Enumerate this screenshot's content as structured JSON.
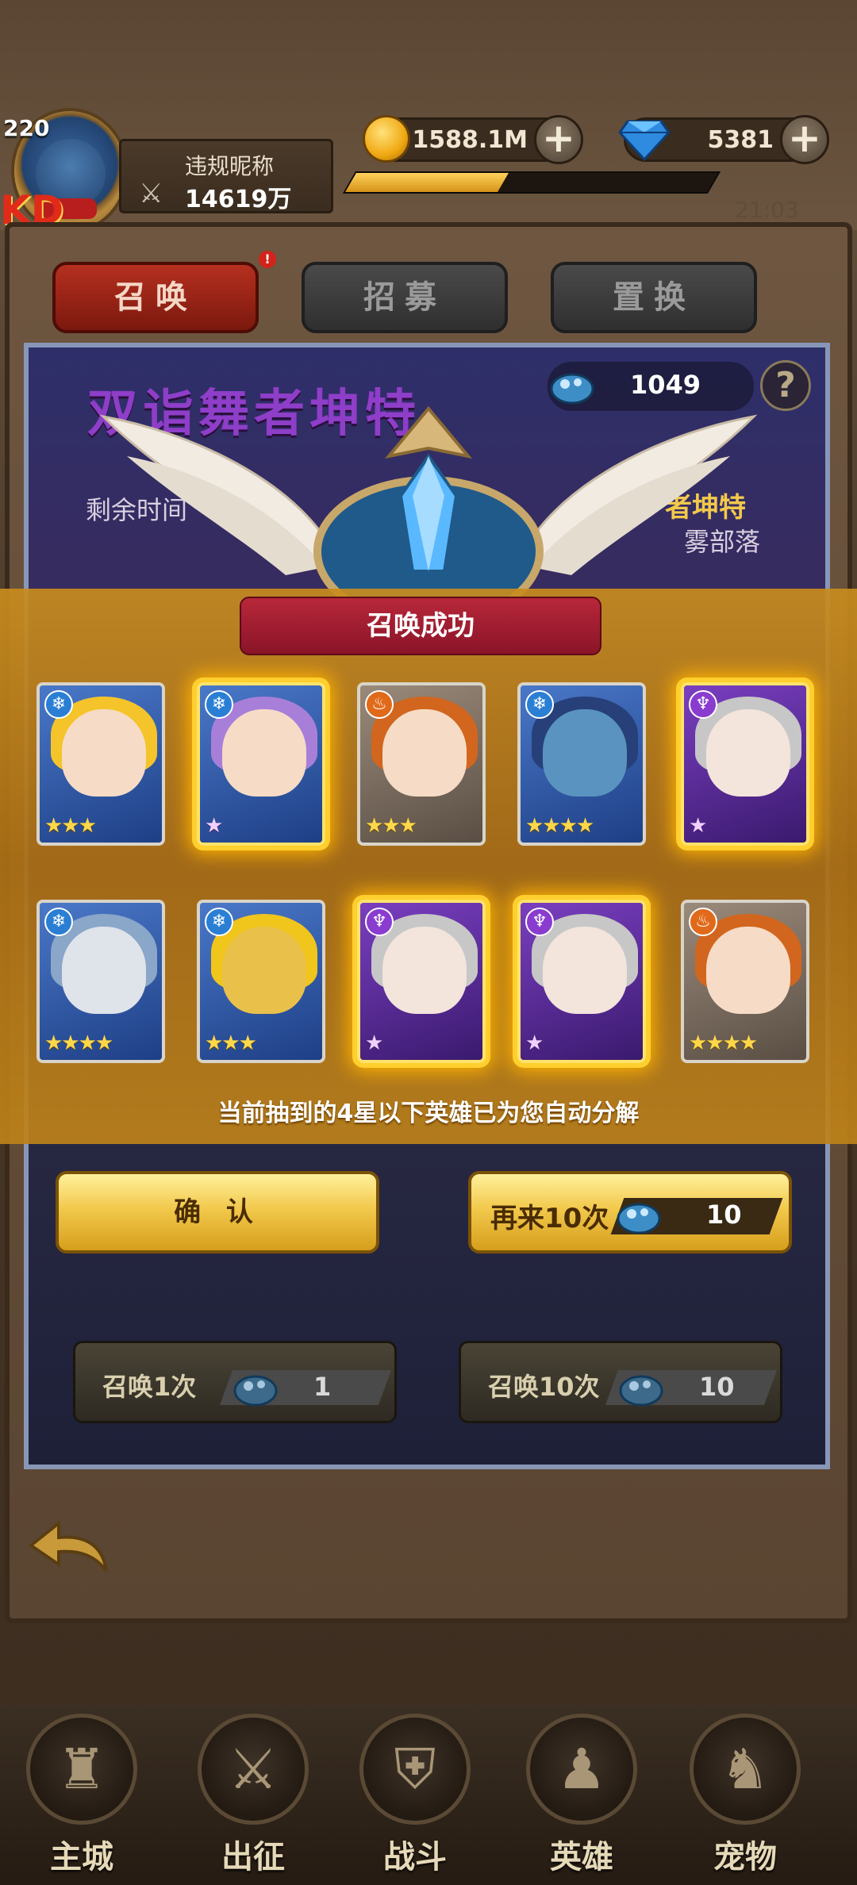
{
  "header": {
    "level": "220",
    "xd": "KD",
    "nickname": "违规昵称",
    "power": "14619万",
    "gold": "1588.1M",
    "gems": "5381",
    "exp_fraction": 0.42,
    "time": "21:03"
  },
  "tabs": [
    {
      "label": "召唤",
      "active": true
    },
    {
      "label": "招募",
      "active": false
    },
    {
      "label": "置换",
      "active": false
    }
  ],
  "tab_badge": "!",
  "banner": {
    "title": "双诣舞者坤特",
    "left_text": "剩余时间",
    "right_title": "者坤特",
    "right_subtitle": "雾部落",
    "ticket_count": "1049",
    "help": "?"
  },
  "result": {
    "title": "召唤成功",
    "note": "当前抽到的4星以下英雄已为您自动分解",
    "cards": [
      {
        "element": "water",
        "stars": 3,
        "star_style": "gold",
        "glow": false
      },
      {
        "element": "water",
        "stars": 1,
        "star_style": "purple",
        "glow": true
      },
      {
        "element": "fire",
        "stars": 3,
        "star_style": "gold",
        "glow": false
      },
      {
        "element": "water",
        "stars": 4,
        "star_style": "gold",
        "glow": false
      },
      {
        "element": "dark",
        "stars": 1,
        "star_style": "purple",
        "glow": true
      },
      {
        "element": "water",
        "stars": 4,
        "star_style": "gold",
        "glow": false
      },
      {
        "element": "water",
        "stars": 3,
        "star_style": "gold",
        "glow": false
      },
      {
        "element": "dark",
        "stars": 1,
        "star_style": "purple",
        "glow": true
      },
      {
        "element": "dark",
        "stars": 1,
        "star_style": "purple",
        "glow": true
      },
      {
        "element": "fire",
        "stars": 4,
        "star_style": "gold",
        "glow": false
      }
    ]
  },
  "buttons": {
    "confirm": "确 认",
    "again_label": "再来10次",
    "again_cost": "10",
    "summon1_label": "召唤1次",
    "summon1_cost": "1",
    "summon10_label": "召唤10次",
    "summon10_cost": "10"
  },
  "nav": [
    {
      "label": "主城",
      "icon": "castle-icon",
      "glyph": "♜"
    },
    {
      "label": "出征",
      "icon": "crossed-axes-icon",
      "glyph": "⚔"
    },
    {
      "label": "战斗",
      "icon": "battle-shield-icon",
      "glyph": "⛨"
    },
    {
      "label": "英雄",
      "icon": "hooded-hero-icon",
      "glyph": "♟"
    },
    {
      "label": "宠物",
      "icon": "pet-dragon-icon",
      "glyph": "♞"
    }
  ],
  "colors": {
    "gold_accent": "#f2c94c",
    "red_tab": "#b5301f",
    "glow": "#ffcf2e"
  }
}
